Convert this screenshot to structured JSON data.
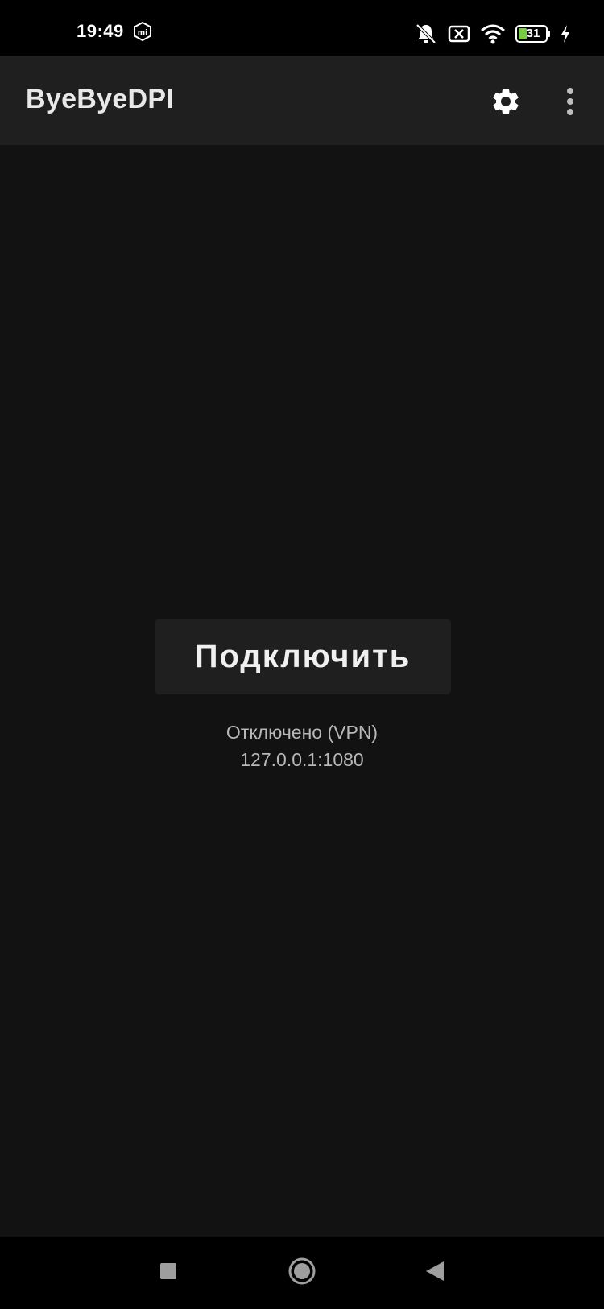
{
  "status_bar": {
    "time": "19:49",
    "battery_level": "31",
    "icons": [
      "mi-icon",
      "muted-bell-icon",
      "no-sim-icon",
      "wifi-icon",
      "battery-icon",
      "charging-icon"
    ]
  },
  "app_bar": {
    "title": "ByeByeDPI",
    "icons": [
      "gear-icon",
      "more-vert-icon"
    ]
  },
  "main": {
    "connect_label": "Подключить",
    "status_line": "Отключено (VPN)",
    "address": "127.0.0.1:1080"
  },
  "nav_bar": {
    "icons": [
      "recents-square-icon",
      "home-circle-icon",
      "back-triangle-icon"
    ]
  },
  "colors": {
    "background": "#121212",
    "app_bar": "#1f1f1f",
    "button": "#1f1f1f",
    "battery_fill": "#7ac943"
  }
}
